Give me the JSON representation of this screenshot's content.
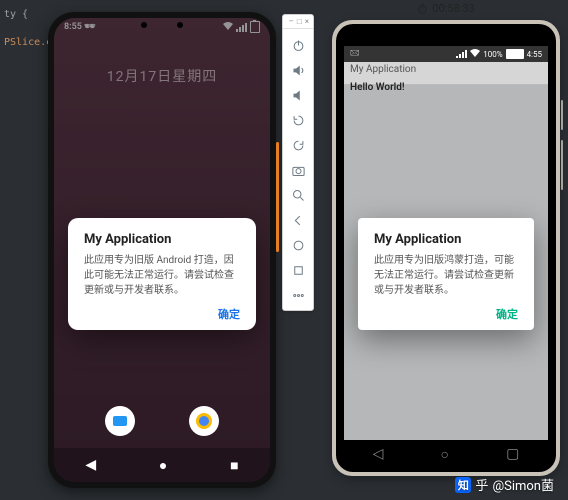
{
  "code": {
    "line1": "ty {",
    "line2": "PSlice.",
    "line2_cls": "cla"
  },
  "phoneA": {
    "status_time": "8:55",
    "status_emoji": "🕶",
    "date_line": "12月17日星期四",
    "dialog": {
      "title": "My Application",
      "body": "此应用专为旧版 Android 打造，因此可能无法正常运行。请尝试检查更新或与开发者联系。",
      "ok": "确定"
    },
    "nav": {
      "back": "◀",
      "home": "●",
      "recent": "■"
    }
  },
  "toolbar": {
    "win_min": "–",
    "win_sq": "□",
    "win_x": "×",
    "icons": [
      "power",
      "vol-up",
      "vol-down",
      "rotate-left",
      "rotate-right",
      "camera",
      "zoom",
      "back-arrow",
      "home-circle",
      "recents-square",
      "more"
    ]
  },
  "timer": {
    "label": "00:58:33"
  },
  "phoneB": {
    "status_left": "🖂",
    "status_batt": "100%",
    "status_time": "4:55",
    "header": "My Application",
    "hello": "Hello World!",
    "dialog": {
      "title": "My Application",
      "body": "此应用专为旧版鸿蒙打造，可能无法正常运行。请尝试检查更新或与开发者联系。",
      "ok": "确定"
    },
    "nav": {
      "back": "◁",
      "home": "○",
      "recent": "▢"
    }
  },
  "watermark": {
    "brand": "知",
    "sep": "乎",
    "author": "@Simon菌"
  }
}
